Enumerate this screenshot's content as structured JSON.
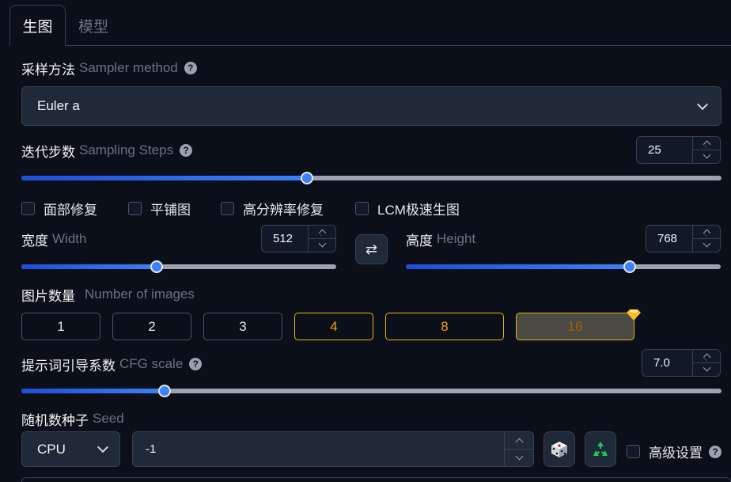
{
  "tabs": {
    "active": "生图",
    "inactive": "模型"
  },
  "sampler": {
    "label": "采样方法",
    "sub": "Sampler method",
    "help": "?",
    "value": "Euler a"
  },
  "steps": {
    "label": "迭代步数",
    "sub": "Sampling Steps",
    "help": "?",
    "value": "25",
    "fill_percent": 40.8
  },
  "options": [
    {
      "label": "面部修复",
      "checked": false
    },
    {
      "label": "平铺图",
      "checked": false
    },
    {
      "label": "高分辨率修复",
      "checked": false
    },
    {
      "label": "LCM极速生图",
      "checked": false
    }
  ],
  "width": {
    "label": "宽度",
    "sub": "Width",
    "value": "512",
    "fill_percent": 43
  },
  "swap": {
    "glyph": "⇄"
  },
  "height": {
    "label": "高度",
    "sub": "Height",
    "value": "768",
    "fill_percent": 71
  },
  "images": {
    "label": "图片数量",
    "sub": "Number of images",
    "buttons": [
      "1",
      "2",
      "3",
      "4",
      "8",
      "16"
    ],
    "selected": "16",
    "premium": [
      "4",
      "8",
      "16"
    ]
  },
  "cfg": {
    "label": "提示词引导系数",
    "sub": "CFG scale",
    "help": "?",
    "value": "7.0",
    "fill_percent": 20.5
  },
  "seed": {
    "label": "随机数种子",
    "sub": "Seed",
    "device": "CPU",
    "value": "-1",
    "advanced_label": "高级设置",
    "help": "?"
  },
  "colors": {
    "accent": "#3b82f6",
    "gold": "#eab308",
    "bg": "#0b0f19",
    "panel": "#1f2937"
  },
  "icons": {
    "random": "dice-icon",
    "recycle": "recycle-icon",
    "swap": "swap-icon",
    "premium": "diamond-icon"
  }
}
